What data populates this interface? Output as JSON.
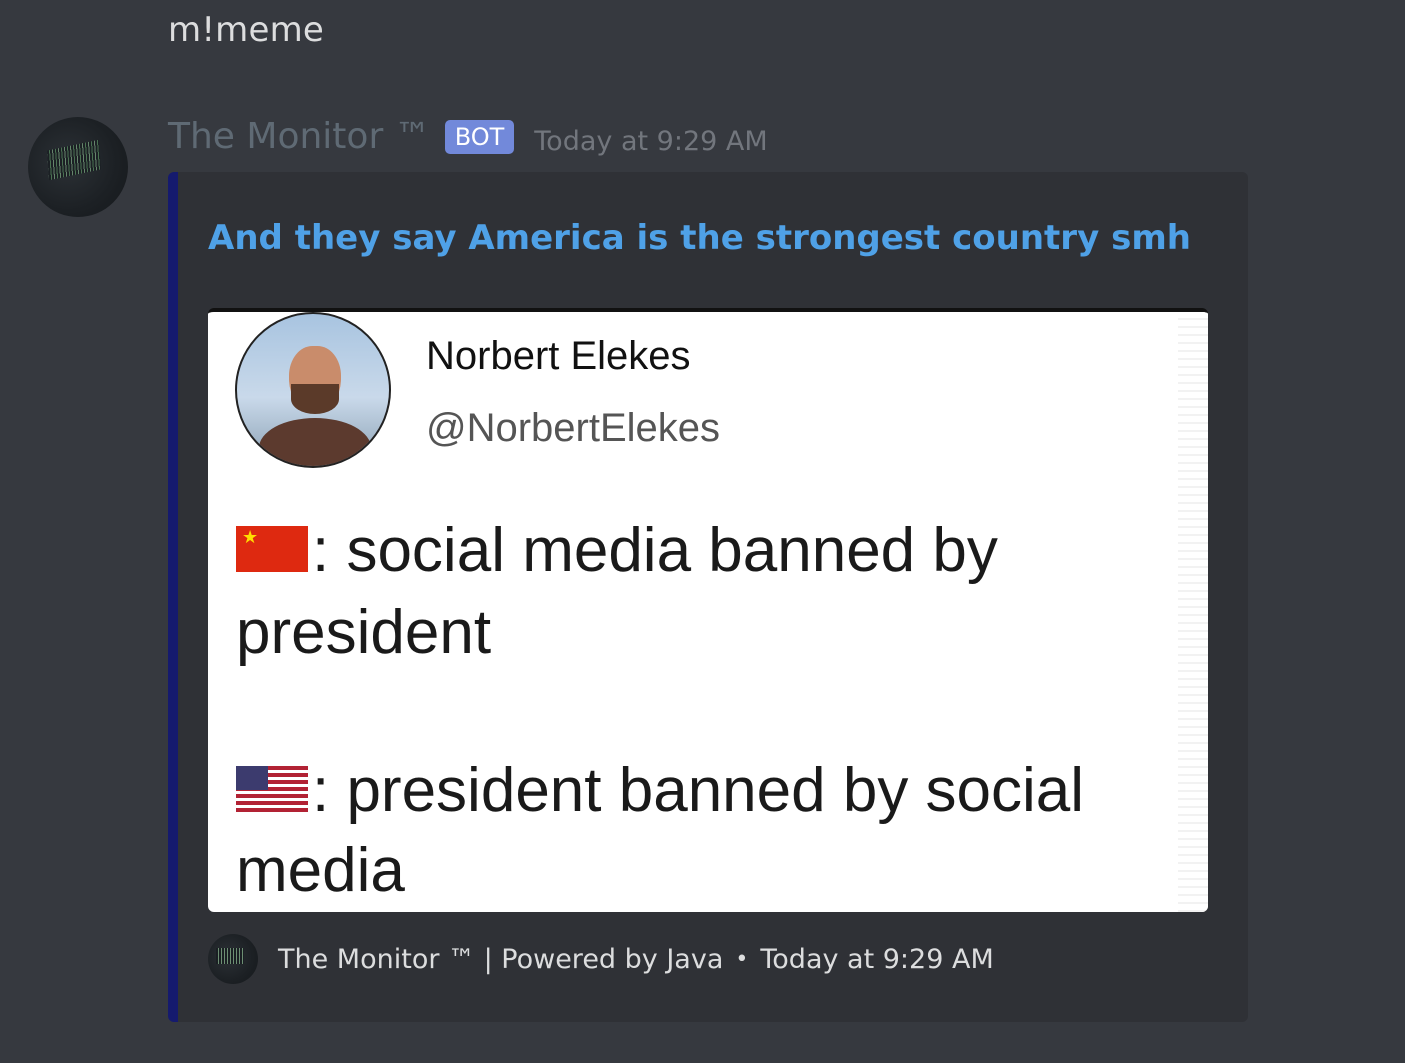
{
  "previous_message": {
    "text": "m!meme"
  },
  "message": {
    "username": "The Monitor ™",
    "bot_tag": "BOT",
    "timestamp": "Today at 9:29 AM",
    "avatar_icon": "avatar-icon"
  },
  "embed": {
    "accent_color": "#151a6e",
    "title": "And they say America is the strongest country smh",
    "title_color": "#4fa1e7",
    "image": {
      "tweet_author": "Norbert Elekes",
      "tweet_handle": "@NorbertElekes",
      "line1_flag": "china-flag-icon",
      "line1_text": ": social media banned by",
      "line2_text": "president",
      "line3_flag": "usa-flag-icon",
      "line3_text": ": president banned by social",
      "line4_text": "media"
    },
    "footer": {
      "text": "The Monitor ™ | Powered by Java",
      "separator": "•",
      "timestamp": "Today at 9:29 AM"
    }
  }
}
